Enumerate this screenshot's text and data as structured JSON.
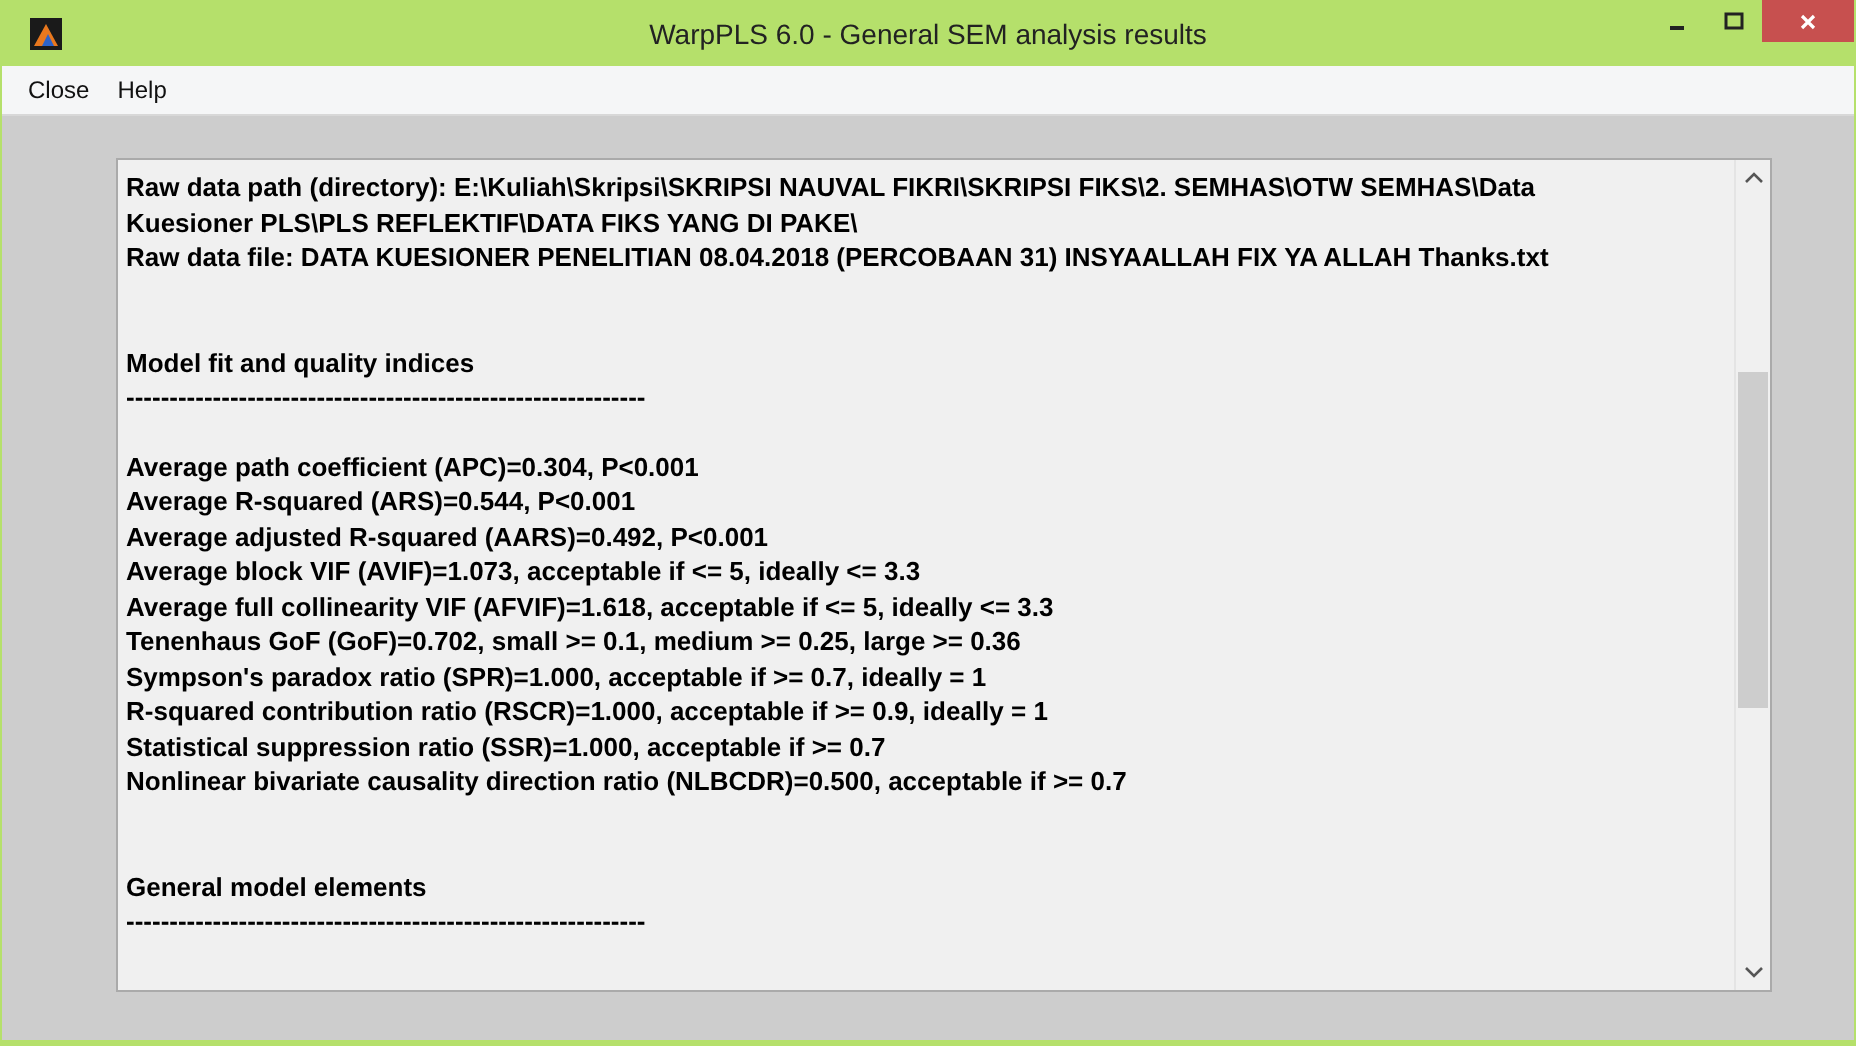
{
  "window": {
    "title": "WarpPLS 6.0 - General SEM analysis results"
  },
  "menu": [
    "Close",
    "Help"
  ],
  "blocks": [
    {
      "lines": [
        "Raw data path (directory): E:\\Kuliah\\Skripsi\\SKRIPSI NAUVAL FIKRI\\SKRIPSI FIKS\\2. SEMHAS\\OTW SEMHAS\\Data",
        "Kuesioner PLS\\PLS REFLEKTIF\\DATA FIKS YANG DI PAKE\\",
        "Raw data file: DATA KUESIONER PENELITIAN 08.04.2018 (PERCOBAAN 31) INSYAALLAH FIX YA ALLAH Thanks.txt"
      ]
    },
    {
      "heading": "Model fit and quality indices",
      "rule": "------------------------------------------------------------",
      "lines": [
        "Average path coefficient (APC)=0.304, P<0.001",
        "Average R-squared (ARS)=0.544, P<0.001",
        "Average adjusted R-squared (AARS)=0.492, P<0.001",
        "Average block VIF (AVIF)=1.073, acceptable if <= 5, ideally <= 3.3",
        "Average full collinearity VIF (AFVIF)=1.618, acceptable if <= 5, ideally <= 3.3",
        "Tenenhaus GoF (GoF)=0.702, small >= 0.1, medium >= 0.25, large >= 0.36",
        "Sympson's paradox ratio (SPR)=1.000, acceptable if >= 0.7, ideally = 1",
        "R-squared contribution ratio (RSCR)=1.000, acceptable if >= 0.9, ideally = 1",
        "Statistical suppression ratio (SSR)=1.000, acceptable if >= 0.7",
        "Nonlinear bivariate causality direction ratio (NLBCDR)=0.500, acceptable if >= 0.7"
      ]
    },
    {
      "heading": "General model elements",
      "rule": "------------------------------------------------------------"
    }
  ]
}
